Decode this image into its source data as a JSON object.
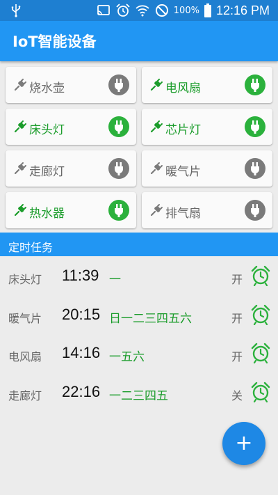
{
  "status_bar": {
    "battery_percent": "100%",
    "time": "12:16 PM",
    "icons": [
      "usb-icon",
      "cast-icon",
      "alarm-icon",
      "wifi-icon",
      "do-not-disturb-icon",
      "battery-icon"
    ]
  },
  "app_bar": {
    "title": "IoT智能设备"
  },
  "devices": [
    {
      "name": "烧水壶",
      "on": false
    },
    {
      "name": "电风扇",
      "on": true
    },
    {
      "name": "床头灯",
      "on": true
    },
    {
      "name": "芯片灯",
      "on": true
    },
    {
      "name": "走廊灯",
      "on": false
    },
    {
      "name": "暖气片",
      "on": false
    },
    {
      "name": "热水器",
      "on": true
    },
    {
      "name": "排气扇",
      "on": false
    }
  ],
  "tasks_section": {
    "title": "定时任务",
    "tasks": [
      {
        "device": "床头灯",
        "time": "11:39",
        "days": "一",
        "action": "开"
      },
      {
        "device": "暖气片",
        "time": "20:15",
        "days": "日一二三四五六",
        "action": "开"
      },
      {
        "device": "电风扇",
        "time": "14:16",
        "days": "一五六",
        "action": "开"
      },
      {
        "device": "走廊灯",
        "time": "22:16",
        "days": "一二三四五",
        "action": "关"
      }
    ]
  },
  "fab": {
    "label": "+"
  },
  "colors": {
    "status_bar": "#1e7fd1",
    "primary": "#2196f3",
    "on": "#2bb13c",
    "off": "#7a7a7a",
    "on_text": "#1a9c2a",
    "fab": "#1e88e5"
  }
}
